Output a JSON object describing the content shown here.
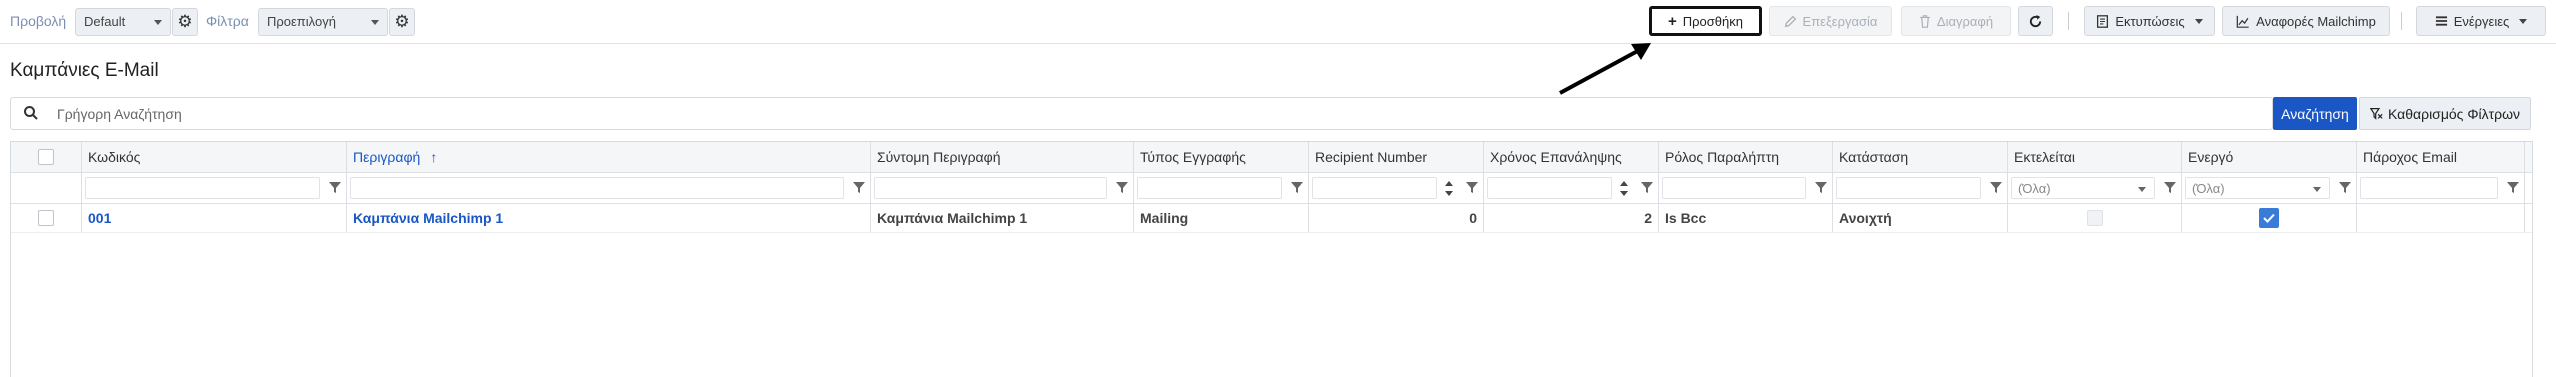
{
  "toolbar": {
    "view_label": "Προβολή",
    "view_value": "Default",
    "filters_label": "Φίλτρα",
    "filters_value": "Προεπιλογή",
    "add_label": "Προσθήκη",
    "edit_label": "Επεξεργασία",
    "delete_label": "Διαγραφή",
    "prints_label": "Εκτυπώσεις",
    "reports_label": "Αναφορές Mailchimp",
    "actions_label": "Ενέργειες"
  },
  "page": {
    "title": "Καμπάνιες E-Mail"
  },
  "search": {
    "placeholder": "Γρήγορη Αναζήτηση",
    "search_button": "Αναζήτηση",
    "clear_button": "Καθαρισμός Φίλτρων"
  },
  "grid": {
    "columns": [
      "Κωδικός",
      "Περιγραφή",
      "Σύντομη Περιγραφή",
      "Τύπος Εγγραφής",
      "Recipient Number",
      "Χρόνος Επανάληψης",
      "Ρόλος Παραλήπτη",
      "Κατάσταση",
      "Εκτελείται",
      "Ενεργό",
      "Πάροχος Email"
    ],
    "sorted_column": "Περιγραφή",
    "sort_direction": "asc",
    "filter_all_label": "(Όλα)",
    "rows": [
      {
        "code": "001",
        "description": "Καμπάνια Mailchimp 1",
        "short_description": "Καμπάνια Mailchimp 1",
        "record_type": "Mailing",
        "recipient_number": "0",
        "repeat_time": "2",
        "recipient_role": "Is Bcc",
        "status": "Ανοιχτή",
        "running": false,
        "active": true,
        "email_provider": ""
      }
    ]
  },
  "colors": {
    "accent": "#1a56c4",
    "checkbox_on": "#3b7bd8"
  }
}
